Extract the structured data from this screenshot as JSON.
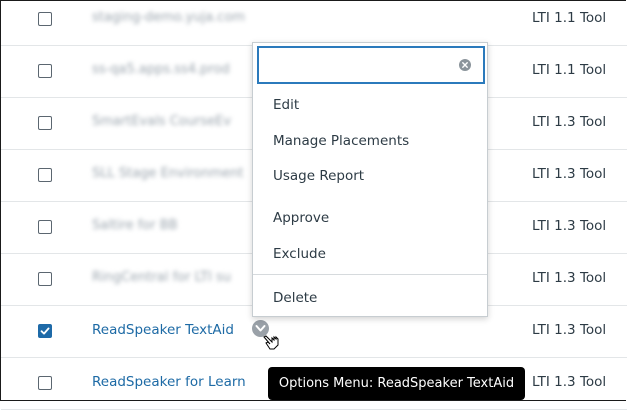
{
  "rows": [
    {
      "name": "staging-demo.yuja.com",
      "type": "LTI 1.1 Tool",
      "checked": false
    },
    {
      "name": "ss-qa5.apps.ss4.prod",
      "type": "LTI 1.1 Tool",
      "checked": false
    },
    {
      "name": "SmartEvals CourseEv",
      "type": "LTI 1.3 Tool",
      "checked": false
    },
    {
      "name": "SLL Stage Environment",
      "type": "LTI 1.3 Tool",
      "checked": false
    },
    {
      "name": "Saltire for BB",
      "type": "LTI 1.3 Tool",
      "checked": false
    },
    {
      "name": "RingCentral for LTI su",
      "type": "LTI 1.3 Tool",
      "checked": false
    },
    {
      "name": "ReadSpeaker TextAid",
      "type": "LTI 1.3 Tool",
      "checked": true
    },
    {
      "name": "ReadSpeaker for Learn",
      "type": "LTI 1.3 Tool",
      "checked": false
    }
  ],
  "menu": {
    "search_placeholder": "",
    "items": [
      "Edit",
      "Manage Placements",
      "Usage Report",
      "Approve",
      "Exclude",
      "Delete"
    ]
  },
  "tooltip": "Options Menu: ReadSpeaker TextAid",
  "colors": {
    "accent": "#1e6aa8",
    "link": "#1d6aa5",
    "tooltip_bg": "#000000"
  }
}
